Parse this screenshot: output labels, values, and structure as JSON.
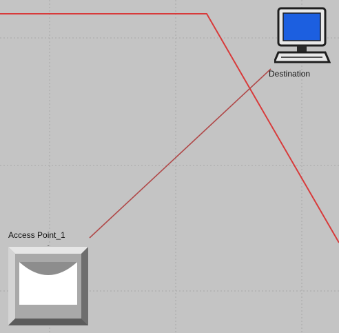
{
  "canvas": {
    "background": "#c4c4c4",
    "grid_color": "#a8a8a8",
    "link_color": "#d83a3a"
  },
  "nodes": {
    "destination": {
      "label": "Destination",
      "icon": "computer-monitor-icon",
      "screen_color": "#1c5fe0"
    },
    "access_point": {
      "label": "Access Point_1",
      "icon": "access-point-icon"
    }
  },
  "links": [
    {
      "name": "red-path-line",
      "color": "#d83a3a"
    },
    {
      "name": "access-point-to-destination-link",
      "color": "#b04848"
    }
  ]
}
